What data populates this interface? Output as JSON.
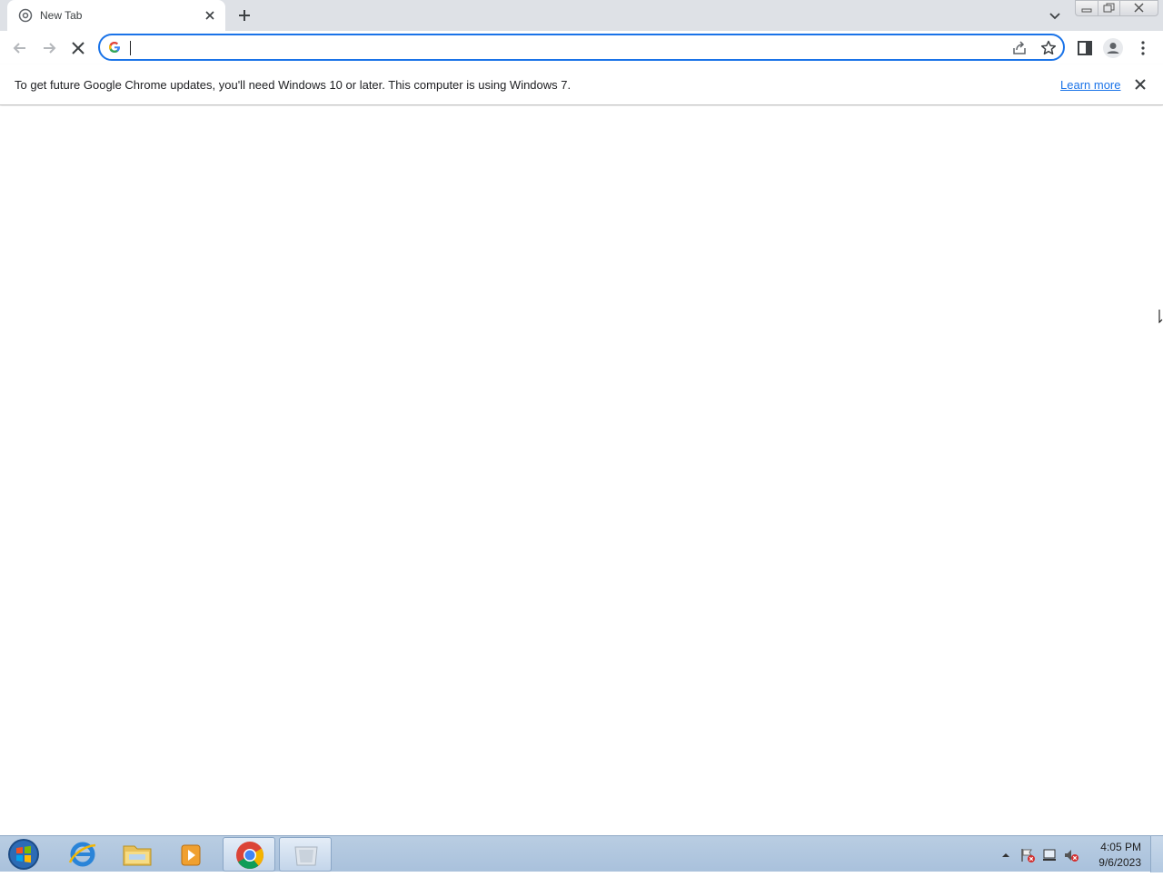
{
  "browser": {
    "tab": {
      "title": "New Tab"
    },
    "omnibox": {
      "value": "",
      "placeholder": ""
    },
    "infobar": {
      "message": "To get future Google Chrome updates, you'll need Windows 10 or later. This computer is using Windows 7.",
      "link": "Learn more"
    }
  },
  "taskbar": {
    "apps": [
      "internet-explorer",
      "windows-explorer",
      "media-player",
      "google-chrome",
      "blank-window"
    ],
    "active_app": "google-chrome",
    "clock": {
      "time": "4:05 PM",
      "date": "9/6/2023"
    }
  },
  "colors": {
    "accent": "#1a73e8",
    "tabstrip": "#dee1e6",
    "taskbar": "#b9cde2"
  }
}
